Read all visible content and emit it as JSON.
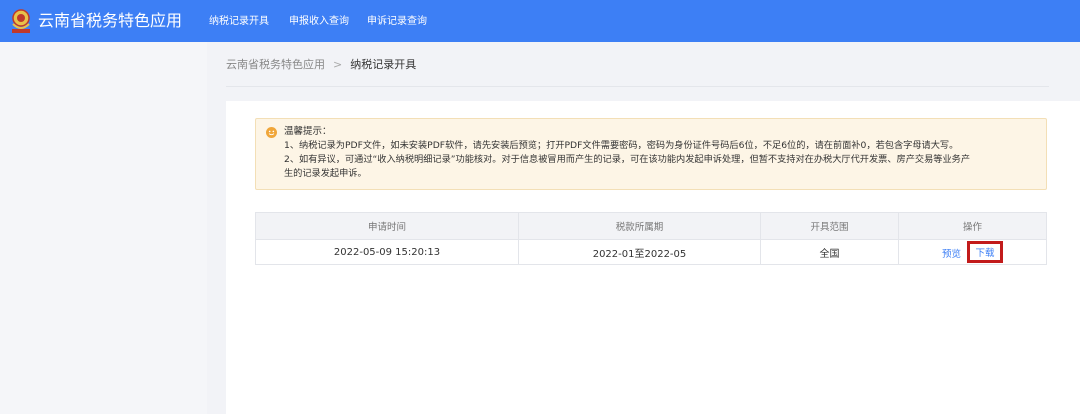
{
  "header": {
    "app_title": "云南省税务特色应用",
    "nav": [
      {
        "label": "纳税记录开具"
      },
      {
        "label": "申报收入查询"
      },
      {
        "label": "申诉记录查询"
      }
    ],
    "accent_color": "#3d7ff5"
  },
  "breadcrumb": {
    "home": "云南省税务特色应用",
    "separator": ">",
    "current": "纳税记录开具"
  },
  "notice": {
    "icon": "smile-icon",
    "title": "温馨提示：",
    "lines": [
      "1、纳税记录为PDF文件，如未安装PDF软件，请先安装后预览；打开PDF文件需要密码，密码为身份证件号码后6位，不足6位的，请在前面补0，若包含字母请大写。",
      "2、如有异议，可通过“收入纳税明细记录”功能核对。对于信息被冒用而产生的记录，可在该功能内发起申诉处理，但暂不支持对在办税大厅代开发票、房产交易等业务产",
      "生的记录发起申诉。"
    ]
  },
  "table": {
    "headers": [
      "申请时间",
      "税款所属期",
      "开具范围",
      "操作"
    ],
    "rows": [
      {
        "apply_time": "2022-05-09 15:20:13",
        "tax_period": "2022-01至2022-05",
        "scope": "全国",
        "preview": "预览",
        "download": "下载"
      }
    ]
  }
}
